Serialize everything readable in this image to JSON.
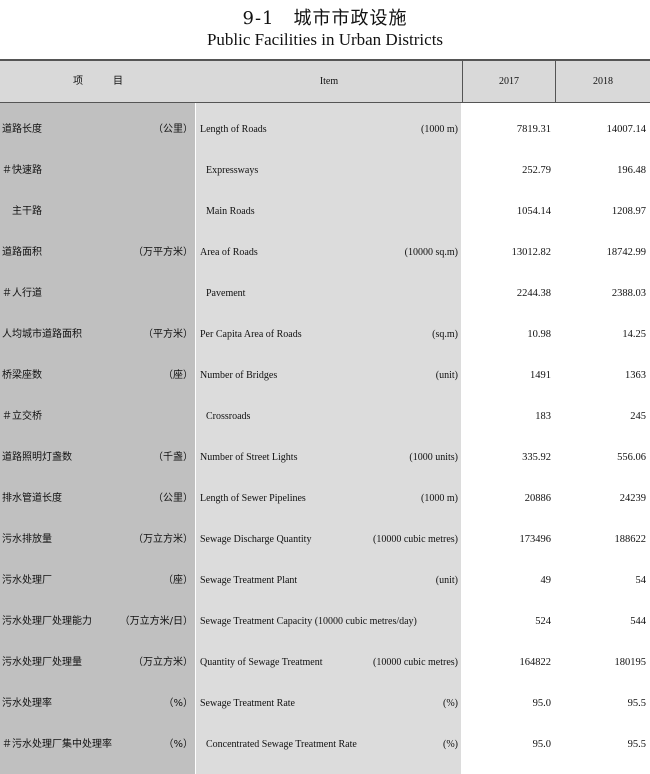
{
  "title": {
    "cn": "9-1　城市市政设施",
    "en": "Public Facilities in Urban Districts"
  },
  "header": {
    "item_cn": "项　　　目",
    "item_en": "Item",
    "year1": "2017",
    "year2": "2018"
  },
  "rows": [
    {
      "cn": "道路长度",
      "unit_cn": "（公里）",
      "en": "Length of Roads",
      "unit_en": "(1000 m)",
      "v2017": "7819.31",
      "v2018": "14007.14",
      "indent": false
    },
    {
      "cn": "＃快速路",
      "unit_cn": "",
      "en": "Expressways",
      "unit_en": "",
      "v2017": "252.79",
      "v2018": "196.48",
      "indent": true
    },
    {
      "cn": "　主干路",
      "unit_cn": "",
      "en": "Main Roads",
      "unit_en": "",
      "v2017": "1054.14",
      "v2018": "1208.97",
      "indent": true
    },
    {
      "cn": "道路面积",
      "unit_cn": "（万平方米）",
      "en": "Area of Roads",
      "unit_en": "(10000 sq.m)",
      "v2017": "13012.82",
      "v2018": "18742.99",
      "indent": false
    },
    {
      "cn": "＃人行道",
      "unit_cn": "",
      "en": "Pavement",
      "unit_en": "",
      "v2017": "2244.38",
      "v2018": "2388.03",
      "indent": true
    },
    {
      "cn": "人均城市道路面积",
      "unit_cn": "（平方米）",
      "en": "Per Capita Area of Roads",
      "unit_en": "(sq.m)",
      "v2017": "10.98",
      "v2018": "14.25",
      "indent": false
    },
    {
      "cn": "桥梁座数",
      "unit_cn": "（座）",
      "en": "Number of Bridges",
      "unit_en": "(unit)",
      "v2017": "1491",
      "v2018": "1363",
      "indent": false
    },
    {
      "cn": "＃立交桥",
      "unit_cn": "",
      "en": "Crossroads",
      "unit_en": "",
      "v2017": "183",
      "v2018": "245",
      "indent": true
    },
    {
      "cn": "道路照明灯盏数",
      "unit_cn": "（千盏）",
      "en": "Number of Street Lights",
      "unit_en": "(1000 units)",
      "v2017": "335.92",
      "v2018": "556.06",
      "indent": false
    },
    {
      "cn": "排水管道长度",
      "unit_cn": "（公里）",
      "en": "Length of Sewer Pipelines",
      "unit_en": "(1000 m)",
      "v2017": "20886",
      "v2018": "24239",
      "indent": false
    },
    {
      "cn": "污水排放量",
      "unit_cn": "（万立方米）",
      "en": "Sewage Discharge Quantity",
      "unit_en": "(10000 cubic metres)",
      "v2017": "173496",
      "v2018": "188622",
      "indent": false
    },
    {
      "cn": "污水处理厂",
      "unit_cn": "（座）",
      "en": "Sewage Treatment Plant",
      "unit_en": "(unit)",
      "v2017": "49",
      "v2018": "54",
      "indent": false
    },
    {
      "cn": "污水处理厂处理能力",
      "unit_cn": "（万立方米/日）",
      "en": "Sewage Treatment Capacity (10000 cubic metres/day)",
      "unit_en": "",
      "v2017": "524",
      "v2018": "544",
      "indent": false
    },
    {
      "cn": "污水处理厂处理量",
      "unit_cn": "（万立方米）",
      "en": "Quantity of Sewage Treatment",
      "unit_en": "(10000 cubic metres)",
      "v2017": "164822",
      "v2018": "180195",
      "indent": false
    },
    {
      "cn": "污水处理率",
      "unit_cn": "（%）",
      "en": "Sewage Treatment Rate",
      "unit_en": "(%)",
      "v2017": "95.0",
      "v2018": "95.5",
      "indent": false
    },
    {
      "cn": "＃污水处理厂集中处理率",
      "unit_cn": "（%）",
      "en": "Concentrated Sewage Treatment Rate",
      "unit_en": "(%)",
      "v2017": "95.0",
      "v2018": "95.5",
      "indent": true
    }
  ]
}
